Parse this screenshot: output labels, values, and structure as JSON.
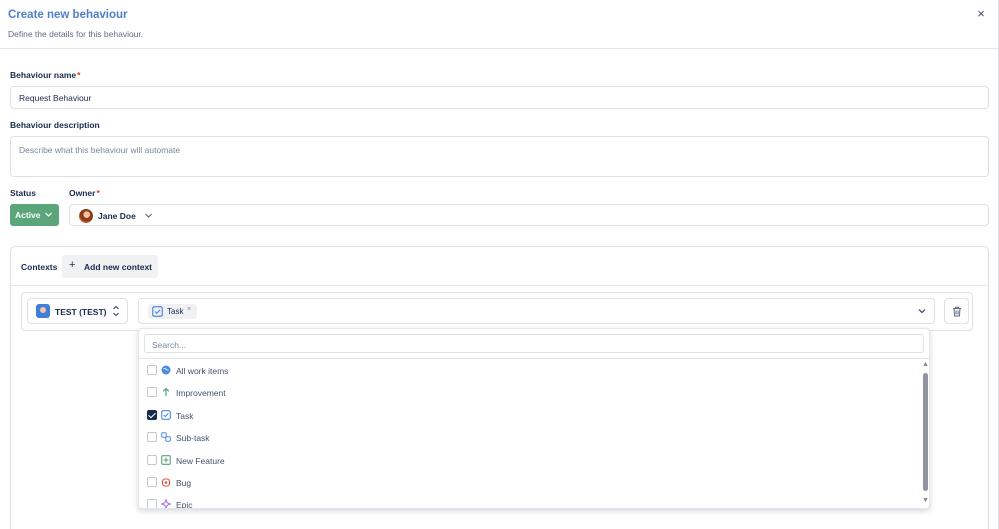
{
  "modal": {
    "title": "Create new behaviour",
    "subtitle": "Define the details for this behaviour.",
    "close_icon": "×"
  },
  "form": {
    "name_label": "Behaviour name",
    "required_mark": "*",
    "name_value": "Request Behaviour",
    "description_label": "Behaviour description",
    "description_placeholder": "Describe what this behaviour will automate",
    "status_label": "Status",
    "status_value": "Active",
    "status_color": "#5aa57a",
    "owner_label": "Owner",
    "owner_name": "Jane Doe"
  },
  "contexts": {
    "title": "Contexts",
    "add_label": "Add new context",
    "project": "TEST (TEST)",
    "selected_chip": "Task",
    "chip_remove": "×"
  },
  "dropdown": {
    "search_placeholder": "Search...",
    "options": [
      {
        "label": "All work items",
        "checked": false,
        "icon": "globe-icon",
        "color": "#4c8be0"
      },
      {
        "label": "Improvement",
        "checked": false,
        "icon": "arrow-up-icon",
        "color": "#5aa57a"
      },
      {
        "label": "Task",
        "checked": true,
        "icon": "task-icon",
        "color": "#4c8be0"
      },
      {
        "label": "Sub-task",
        "checked": false,
        "icon": "subtask-icon",
        "color": "#4c8be0"
      },
      {
        "label": "New Feature",
        "checked": false,
        "icon": "plus-box-icon",
        "color": "#5aa57a"
      },
      {
        "label": "Bug",
        "checked": false,
        "icon": "bug-icon",
        "color": "#e5493a"
      },
      {
        "label": "Epic",
        "checked": false,
        "icon": "epic-icon",
        "color": "#a56ee0"
      }
    ]
  }
}
